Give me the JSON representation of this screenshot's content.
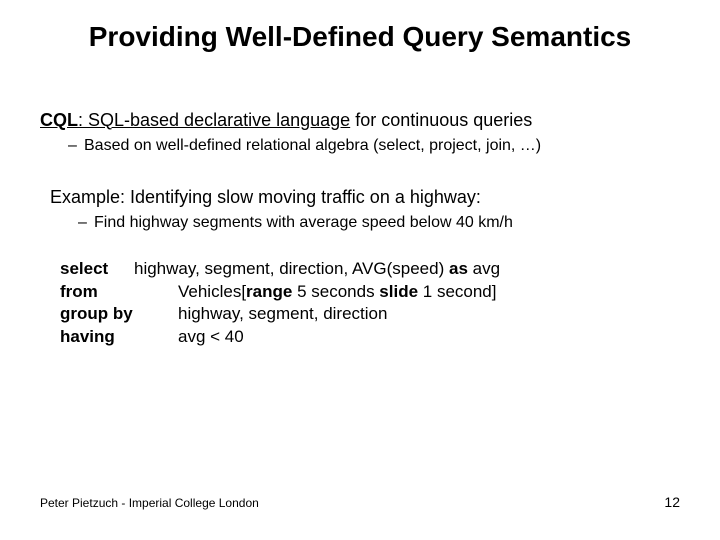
{
  "title": "Providing Well-Defined Query Semantics",
  "intro": {
    "lead_bold": "CQL",
    "lead_rest": ": SQL-based declarative language",
    "lead_tail": " for continuous queries",
    "bullet": "Based on well-defined relational algebra (select, project, join, …)"
  },
  "example": {
    "heading": "Example: Identifying slow moving traffic on a highway:",
    "bullet": "Find highway segments with average speed below 40 km/h"
  },
  "query": {
    "select_kw": "select",
    "select_val_pre": "highway, segment, direction, AVG(speed) ",
    "select_as": "as",
    "select_val_post": " avg",
    "from_kw": "from",
    "from_val_pre": "Vehicles[",
    "from_range": "range",
    "from_mid": " 5 seconds ",
    "from_slide": "slide",
    "from_tail": " 1 second]",
    "group_kw": "group by",
    "group_val": "highway, segment, direction",
    "having_kw": "having",
    "having_val": "avg < 40"
  },
  "footer": {
    "author": "Peter Pietzuch - Imperial College London",
    "page": "12"
  },
  "dash": "–"
}
